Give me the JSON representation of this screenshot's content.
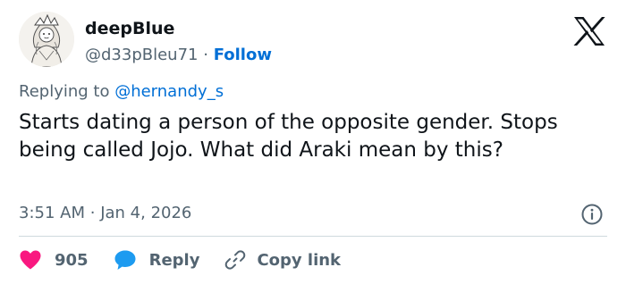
{
  "author": {
    "display_name": "deepBlue",
    "handle": "@d33pBleu71",
    "separator": "·",
    "follow_label": "Follow"
  },
  "reply_context": {
    "prefix": "Replying to ",
    "mention": "@hernandy_s"
  },
  "tweet": {
    "text": "Starts dating a person of the opposite gender. Stops being called Jojo. What did Araki mean by this?",
    "time": "3:51 AM",
    "separator": "·",
    "date": "Jan 4, 2026"
  },
  "actions": {
    "like_count": "905",
    "reply_label": "Reply",
    "copy_label": "Copy link"
  },
  "icons": {
    "brand": "x-logo-icon",
    "info": "info-icon",
    "like": "heart-icon",
    "reply": "chat-bubble-icon",
    "copy": "link-icon"
  },
  "colors": {
    "accent": "#006fd6",
    "like": "#f91880",
    "reply": "#1d9bf0",
    "secondary_text": "#536471",
    "divider": "#cfd9de"
  }
}
